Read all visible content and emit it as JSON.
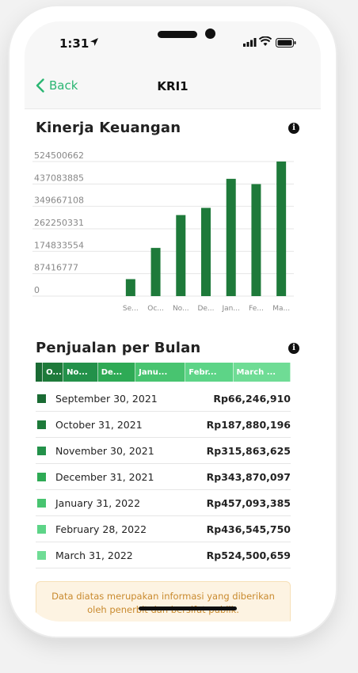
{
  "status": {
    "time": "1:31"
  },
  "nav": {
    "back_label": "Back",
    "title": "KRI1"
  },
  "finance_section": {
    "title": "Kinerja Keuangan"
  },
  "sales_section": {
    "title": "Penjualan per Bulan"
  },
  "chart_data": {
    "type": "bar",
    "categories": [
      "Se...",
      "Oc...",
      "No...",
      "De...",
      "Jan...",
      "Fe...",
      "Ma..."
    ],
    "values": [
      66246910,
      187880196,
      315863625,
      343870097,
      457093385,
      436545750,
      524500659
    ],
    "y_ticks": [
      "524500662",
      "437083885",
      "349667108",
      "262250331",
      "174833554",
      "87416777",
      "0"
    ],
    "ylim": [
      0,
      524500662
    ],
    "grid": true,
    "colors": {
      "bar": "#1e7a3a"
    }
  },
  "segments": [
    {
      "label": "",
      "color": "#1a6b34"
    },
    {
      "label": "O...",
      "color": "#1e7a3a"
    },
    {
      "label": "No...",
      "color": "#23914a"
    },
    {
      "label": "De...",
      "color": "#2eaa55"
    },
    {
      "label": "Janu...",
      "color": "#48c470"
    },
    {
      "label": "Febr...",
      "color": "#5dd487"
    },
    {
      "label": "March ...",
      "color": "#6fdc95"
    }
  ],
  "sales": [
    {
      "date": "September 30, 2021",
      "value": "Rp66,246,910",
      "color": "#1a6b34"
    },
    {
      "date": "October 31, 2021",
      "value": "Rp187,880,196",
      "color": "#1e7a3a"
    },
    {
      "date": "November 30, 2021",
      "value": "Rp315,863,625",
      "color": "#23914a"
    },
    {
      "date": "December 31, 2021",
      "value": "Rp343,870,097",
      "color": "#2eaa55"
    },
    {
      "date": "January 31, 2022",
      "value": "Rp457,093,385",
      "color": "#48c470"
    },
    {
      "date": "February 28, 2022",
      "value": "Rp436,545,750",
      "color": "#5dd487"
    },
    {
      "date": "March 31, 2022",
      "value": "Rp524,500,659",
      "color": "#6fdc95"
    }
  ],
  "notice": {
    "text": "Data diatas merupakan informasi yang diberikan oleh penerbit dan bersifat publik."
  },
  "colors": {
    "accent": "#2bb673",
    "notice_bg": "#fdf3e2",
    "notice_text": "#c98a2e"
  }
}
